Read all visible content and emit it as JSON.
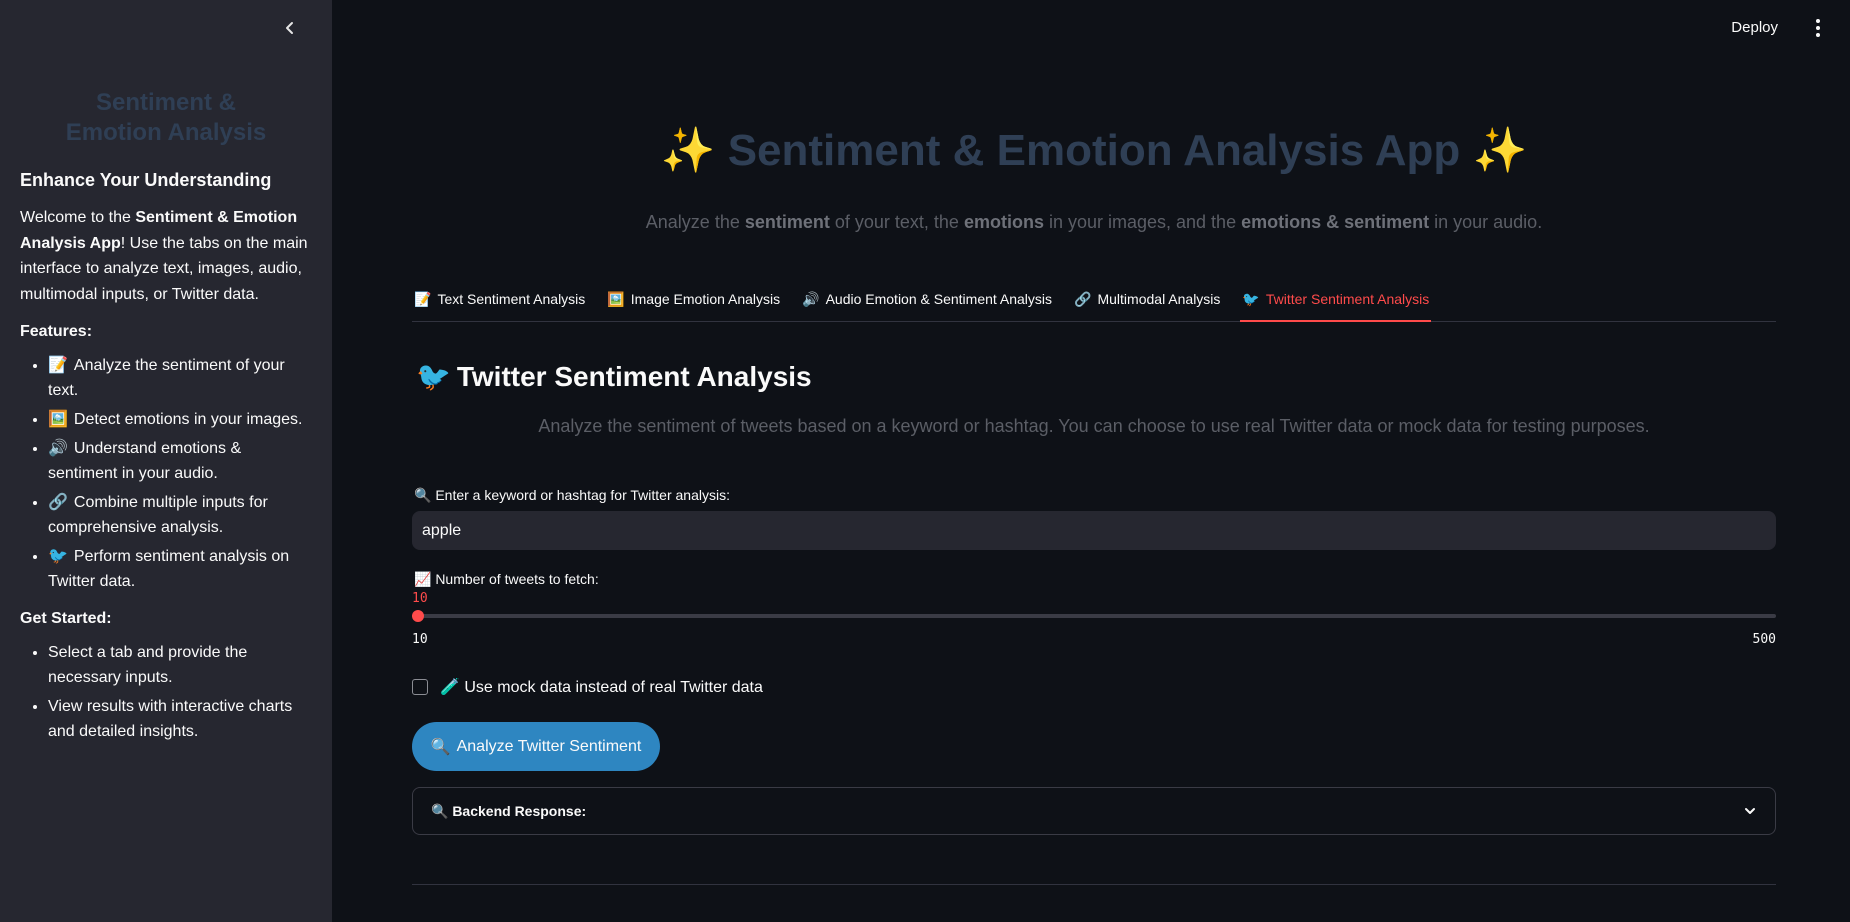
{
  "sidebar": {
    "title": "Sentiment & Emotion Analysis",
    "heading": "Enhance Your Understanding",
    "welcome_pre": "Welcome to the ",
    "welcome_bold": "Sentiment & Emotion Analysis App",
    "welcome_post": "! Use the tabs on the main interface to analyze text, images, audio, multimodal inputs, or Twitter data.",
    "features_label": "Features:",
    "features": [
      {
        "icon": "📝",
        "text": "Analyze the sentiment of your text."
      },
      {
        "icon": "🖼️",
        "text": "Detect emotions in your images."
      },
      {
        "icon": "🔊",
        "text": "Understand emotions & sentiment in your audio."
      },
      {
        "icon": "🔗",
        "text": "Combine multiple inputs for comprehensive analysis."
      },
      {
        "icon": "🐦",
        "text": "Perform sentiment analysis on Twitter data."
      }
    ],
    "get_started_label": "Get Started:",
    "get_started": [
      "Select a tab and provide the necessary inputs.",
      "View results with interactive charts and detailed insights."
    ]
  },
  "header": {
    "deploy_label": "Deploy"
  },
  "main": {
    "title_spark": "✨",
    "title_text": "Sentiment & Emotion Analysis App",
    "subtitle": {
      "p1": "Analyze the ",
      "b1": "sentiment",
      "p2": " of your text, the ",
      "b2": "emotions",
      "p3": " in your images, and the ",
      "b3": "emotions & sentiment",
      "p4": " in your audio."
    },
    "tabs": [
      {
        "icon": "📝",
        "label": "Text Sentiment Analysis",
        "active": false
      },
      {
        "icon": "🖼️",
        "label": "Image Emotion Analysis",
        "active": false
      },
      {
        "icon": "🔊",
        "label": "Audio Emotion & Sentiment Analysis",
        "active": false
      },
      {
        "icon": "🔗",
        "label": "Multimodal Analysis",
        "active": false
      },
      {
        "icon": "🐦",
        "label": "Twitter Sentiment Analysis",
        "active": true
      }
    ],
    "section_icon": "🐦",
    "section_title": "Twitter Sentiment Analysis",
    "section_desc": "Analyze the sentiment of tweets based on a keyword or hashtag. You can choose to use real Twitter data or mock data for testing purposes.",
    "keyword_label": "🔍 Enter a keyword or hashtag for Twitter analysis:",
    "keyword_value": "apple",
    "tweets_label": "📈 Number of tweets to fetch:",
    "slider": {
      "value": "10",
      "min": "10",
      "max": "500",
      "fraction": 0
    },
    "mock_label": "🧪 Use mock data instead of real Twitter data",
    "mock_checked": false,
    "analyze_icon": "🔍",
    "analyze_label": "Analyze Twitter Sentiment",
    "backend_label": "🔍 Backend Response:"
  },
  "colors": {
    "accent": "#ff4b4b",
    "button": "#2e86c1",
    "sidebar_bg": "#262730",
    "main_bg": "#0e1117"
  }
}
